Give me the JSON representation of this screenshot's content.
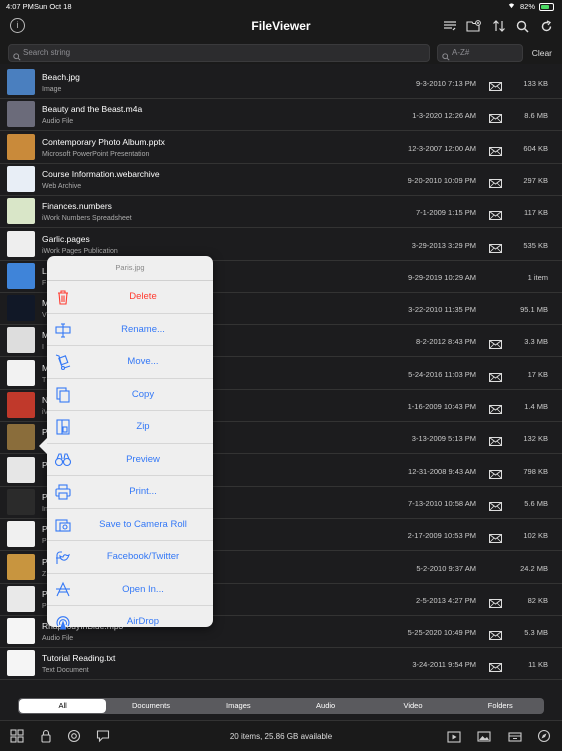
{
  "status_bar": {
    "time": "4:07 PM",
    "date": "Sun Oct 18",
    "battery": "82%"
  },
  "nav": {
    "title": "FileViewer"
  },
  "search": {
    "placeholder": "Search string",
    "az_placeholder": "A-Z#",
    "clear_label": "Clear"
  },
  "files": [
    {
      "name": "Beach.jpg",
      "kind": "Image",
      "date": "9-3-2010 7:13 PM",
      "size": "133 KB",
      "thumb_color": "#4a7fbf",
      "mail": true
    },
    {
      "name": "Beauty and the Beast.m4a",
      "kind": "Audio File",
      "date": "1-3-2020 12:26 AM",
      "size": "8.6 MB",
      "thumb_color": "#6b6b7a",
      "mail": true
    },
    {
      "name": "Contemporary Photo Album.pptx",
      "kind": "Microsoft PowerPoint Presentation",
      "date": "12-3-2007 12:00 AM",
      "size": "604 KB",
      "thumb_color": "#c98a3a",
      "mail": true
    },
    {
      "name": "Course Information.webarchive",
      "kind": "Web Archive",
      "date": "9-20-2010 10:09 PM",
      "size": "297 KB",
      "thumb_color": "#e8eef6",
      "mail": true
    },
    {
      "name": "Finances.numbers",
      "kind": "iWork Numbers Spreadsheet",
      "date": "7-1-2009 1:15 PM",
      "size": "117 KB",
      "thumb_color": "#d9e6c8",
      "mail": true
    },
    {
      "name": "Garlic.pages",
      "kind": "iWork Pages Publication",
      "date": "3-29-2013 3:29 PM",
      "size": "535 KB",
      "thumb_color": "#eeeeee",
      "mail": true
    },
    {
      "name": "L",
      "kind": "F",
      "date": "9-29-2019 10:29 AM",
      "size": "1 item",
      "thumb_color": "#3f84d9",
      "mail": false
    },
    {
      "name": "M",
      "kind": "V",
      "date": "3-22-2010 11:35 PM",
      "size": "95.1 MB",
      "thumb_color": "#111827",
      "mail": false
    },
    {
      "name": "M",
      "kind": "I",
      "date": "8-2-2012 8:43 PM",
      "size": "3.3 MB",
      "thumb_color": "#dddddd",
      "mail": true
    },
    {
      "name": "M",
      "kind": "T",
      "date": "5-24-2016 11:03 PM",
      "size": "17 KB",
      "thumb_color": "#f2f2f2",
      "mail": true
    },
    {
      "name": "N",
      "kind": "iV",
      "date": "1-16-2009 10:43 PM",
      "size": "1.4 MB",
      "thumb_color": "#c0392b",
      "mail": true
    },
    {
      "name": "P",
      "kind": "",
      "date": "3-13-2009 5:13 PM",
      "size": "132 KB",
      "thumb_color": "#8a6d3b",
      "mail": true
    },
    {
      "name": "P",
      "kind": "",
      "date": "12-31-2008 9:43 AM",
      "size": "798 KB",
      "thumb_color": "#e6e6e6",
      "mail": true
    },
    {
      "name": "P",
      "kind": "In",
      "date": "7-13-2010 10:58 AM",
      "size": "5.6 MB",
      "thumb_color": "#2b2b2b",
      "mail": true
    },
    {
      "name": "P",
      "kind": "P",
      "date": "2-17-2009 10:53 PM",
      "size": "102 KB",
      "thumb_color": "#f0f0f0",
      "mail": true
    },
    {
      "name": "P",
      "kind": "Z",
      "date": "5-2-2010 9:37 AM",
      "size": "24.2 MB",
      "thumb_color": "#c8953f",
      "mail": false
    },
    {
      "name": "P",
      "kind": "P",
      "date": "2-5-2013 4:27 PM",
      "size": "82 KB",
      "thumb_color": "#e9e9e9",
      "mail": true
    },
    {
      "name": "RhapsodyInBlue.mp3",
      "kind": "Audio File",
      "date": "5-25-2020 10:49 PM",
      "size": "5.3 MB",
      "thumb_color": "#f5f5f5",
      "mail": true
    },
    {
      "name": "Tutorial Reading.txt",
      "kind": "Text Document",
      "date": "3-24-2011 9:54 PM",
      "size": "11 KB",
      "thumb_color": "#f5f5f5",
      "mail": true
    }
  ],
  "popover": {
    "title": "Paris.jpg",
    "items": [
      {
        "label": "Delete",
        "icon": "trash-icon"
      },
      {
        "label": "Rename...",
        "icon": "rename-icon"
      },
      {
        "label": "Move...",
        "icon": "dolly-icon"
      },
      {
        "label": "Copy",
        "icon": "copy-icon"
      },
      {
        "label": "Zip",
        "icon": "zip-icon"
      },
      {
        "label": "Preview",
        "icon": "binoculars-icon"
      },
      {
        "label": "Print...",
        "icon": "printer-icon"
      },
      {
        "label": "Save to Camera Roll",
        "icon": "camera-roll-icon"
      },
      {
        "label": "Facebook/Twitter",
        "icon": "social-icon"
      },
      {
        "label": "Open In...",
        "icon": "open-in-icon"
      },
      {
        "label": "AirDrop",
        "icon": "airdrop-icon"
      }
    ]
  },
  "filter_tabs": [
    "All",
    "Documents",
    "Images",
    "Audio",
    "Video",
    "Folders"
  ],
  "bottom": {
    "status": "20 items, 25.86 GB available"
  },
  "colors": {
    "accent": "#3478f6",
    "danger": "#ff3b30",
    "background": "#1c1c1e"
  }
}
